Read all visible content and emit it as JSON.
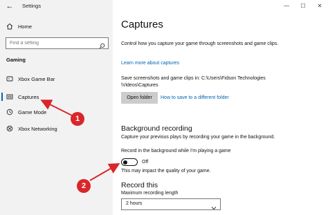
{
  "window": {
    "title": "Settings",
    "back_icon": "back-arrow-icon",
    "minimize_glyph": "—",
    "maximize_glyph": "☐",
    "close_glyph": "✕"
  },
  "sidebar": {
    "home_label": "Home",
    "search_placeholder": "Find a setting",
    "section_label": "Gaming",
    "items": [
      {
        "label": "Xbox Game Bar",
        "icon": "xbox-game-bar-icon"
      },
      {
        "label": "Captures",
        "icon": "captures-icon",
        "selected": true
      },
      {
        "label": "Game Mode",
        "icon": "game-mode-icon"
      },
      {
        "label": "Xbox Networking",
        "icon": "xbox-icon"
      }
    ]
  },
  "main": {
    "title": "Captures",
    "description": "Control how you capture your game through screenshots and game clips.",
    "learn_more_link": "Learn more about captures",
    "save_location_text": "Save screenshots and game clips in: C:\\Users\\Fidson Technologies \\Videos\\Captures",
    "open_folder_button": "Open folder",
    "folder_help_link": "How to save to a different folder",
    "background_recording": {
      "title": "Background recording",
      "description": "Capture your previous plays by recording your game in the background.",
      "toggle_label": "Record in the background while I'm playing a game",
      "toggle_state": "Off",
      "impact_note": "This may impact the quality of your game."
    },
    "record_this": {
      "title": "Record this",
      "max_length_label": "Maximum recording length",
      "max_length_value": "2 hours"
    }
  },
  "annotations": [
    {
      "number": "1",
      "color": "#d9262a"
    },
    {
      "number": "2",
      "color": "#d9262a"
    }
  ],
  "colors": {
    "accent": "#0063b1",
    "sidebar_bg": "#f2f2f2",
    "button_bg": "#cccccc",
    "annotation": "#d9262a"
  }
}
